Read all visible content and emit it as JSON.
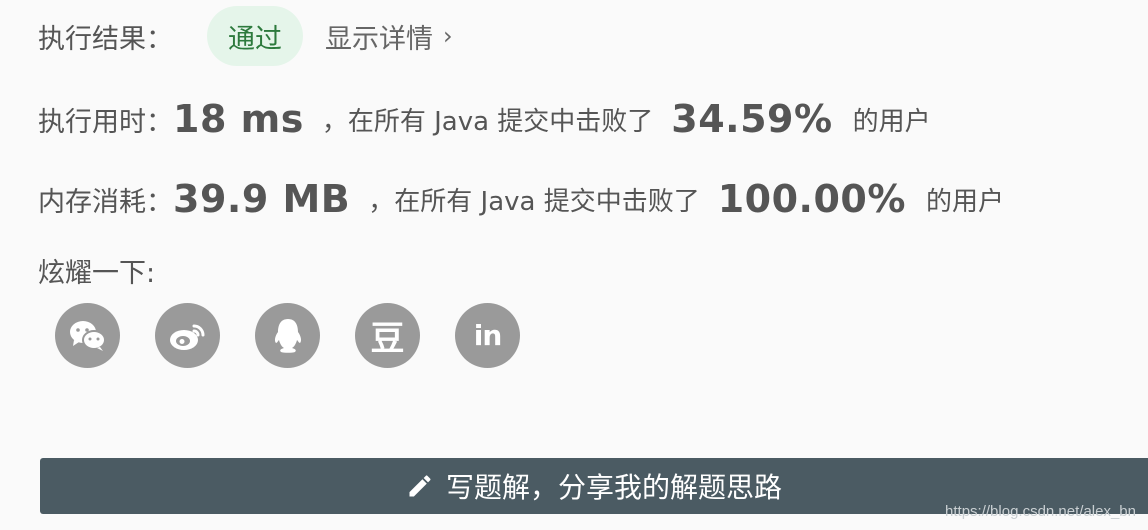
{
  "result": {
    "label": "执行结果：",
    "status": "通过",
    "detail_link": "显示详情",
    "detail_chevron": "›"
  },
  "runtime": {
    "label": "执行用时：",
    "value": "18 ms",
    "middle_text": "，在所有 Java 提交中击败了",
    "percent": "34.59%",
    "suffix": "的用户"
  },
  "memory": {
    "label": "内存消耗：",
    "value": "39.9 MB",
    "middle_text": "，在所有 Java 提交中击败了",
    "percent": "100.00%",
    "suffix": "的用户"
  },
  "share": {
    "label": "炫耀一下:",
    "icons": [
      "wechat-icon",
      "weibo-icon",
      "qq-icon",
      "douban-icon",
      "linkedin-icon"
    ],
    "douban_glyph": "豆",
    "linkedin_glyph": "in"
  },
  "write_button": {
    "label": "写题解，分享我的解题思路",
    "icon": "pencil-icon"
  },
  "watermark": "https://blog.csdn.net/alex_bn",
  "colors": {
    "badge_bg": "#e5f5ea",
    "badge_text": "#2d7a3d",
    "button_bg": "#4b5b63",
    "icon_bg": "#9a9a9a"
  }
}
